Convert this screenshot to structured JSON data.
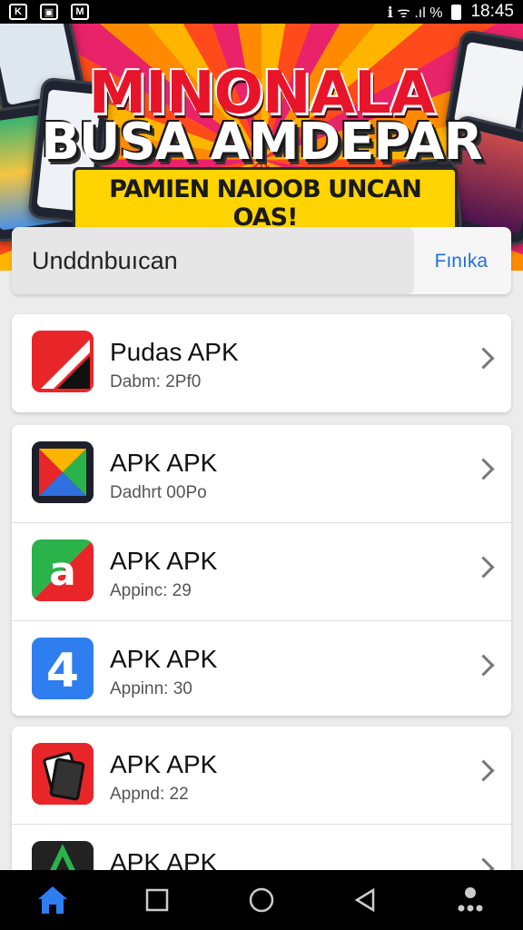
{
  "status_bar": {
    "left_icons": [
      "K",
      "▣",
      "M"
    ],
    "right_status": "ℹ ᯤ .ıl %",
    "time": "18:45"
  },
  "banner": {
    "title_line1": "MINONALA",
    "title_line2": "BUSA AMDEPAR",
    "subtitle": "PAMIEN NAIOOB UNCAN OAS!"
  },
  "search": {
    "placeholder": "Unddnbuıcan",
    "button_label": "Fınıka"
  },
  "apps": [
    {
      "name": "Pudas APK",
      "sub": "Dabm: 2Pf0",
      "icon": "red-slash-icon"
    },
    {
      "name": "APK APK",
      "sub": "Dadhrt 00Po",
      "icon": "colorful-triangle-icon"
    },
    {
      "name": "APK APK",
      "sub": "Appinc: 29",
      "icon": "green-red-a-icon"
    },
    {
      "name": "APK APK",
      "sub": "Appinn: 30",
      "icon": "blue-4-icon"
    },
    {
      "name": "APK APK",
      "sub": "Appnd: 22",
      "icon": "red-cards-icon"
    },
    {
      "name": "APK APK",
      "sub": "",
      "icon": "green-triangle-icon"
    }
  ],
  "navbar": {
    "items": [
      "home-icon",
      "square-icon",
      "circle-icon",
      "back-triangle-icon",
      "more-dots-icon"
    ]
  },
  "colors": {
    "accent": "#1f6fd8",
    "banner_red": "#e8142a",
    "banner_yellow": "#ffd400"
  }
}
